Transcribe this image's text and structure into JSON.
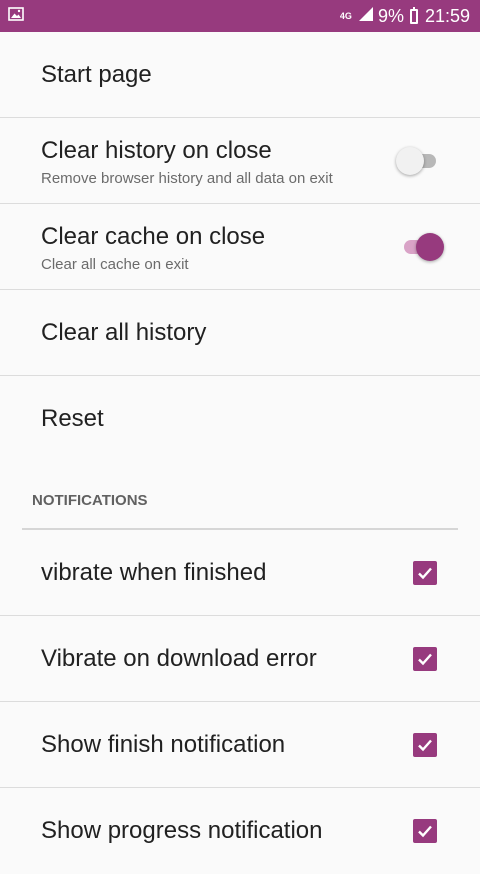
{
  "status_bar": {
    "network": "4G",
    "battery": "9%",
    "time": "21:59",
    "accent_color": "#973a7e"
  },
  "settings": {
    "start_page": {
      "title": "Start page"
    },
    "clear_history_on_close": {
      "title": "Clear history on close",
      "summary": "Remove browser history and all data on exit",
      "enabled": false
    },
    "clear_cache_on_close": {
      "title": "Clear cache on close",
      "summary": "Clear all cache on exit",
      "enabled": true
    },
    "clear_all_history": {
      "title": "Clear all history"
    },
    "reset": {
      "title": "Reset"
    }
  },
  "notifications": {
    "header": "NOTIFICATIONS",
    "items": [
      {
        "title": "vibrate when finished",
        "checked": true
      },
      {
        "title": "Vibrate on download error",
        "checked": true
      },
      {
        "title": "Show finish notification",
        "checked": true
      },
      {
        "title": "Show progress notification",
        "checked": true
      }
    ]
  }
}
